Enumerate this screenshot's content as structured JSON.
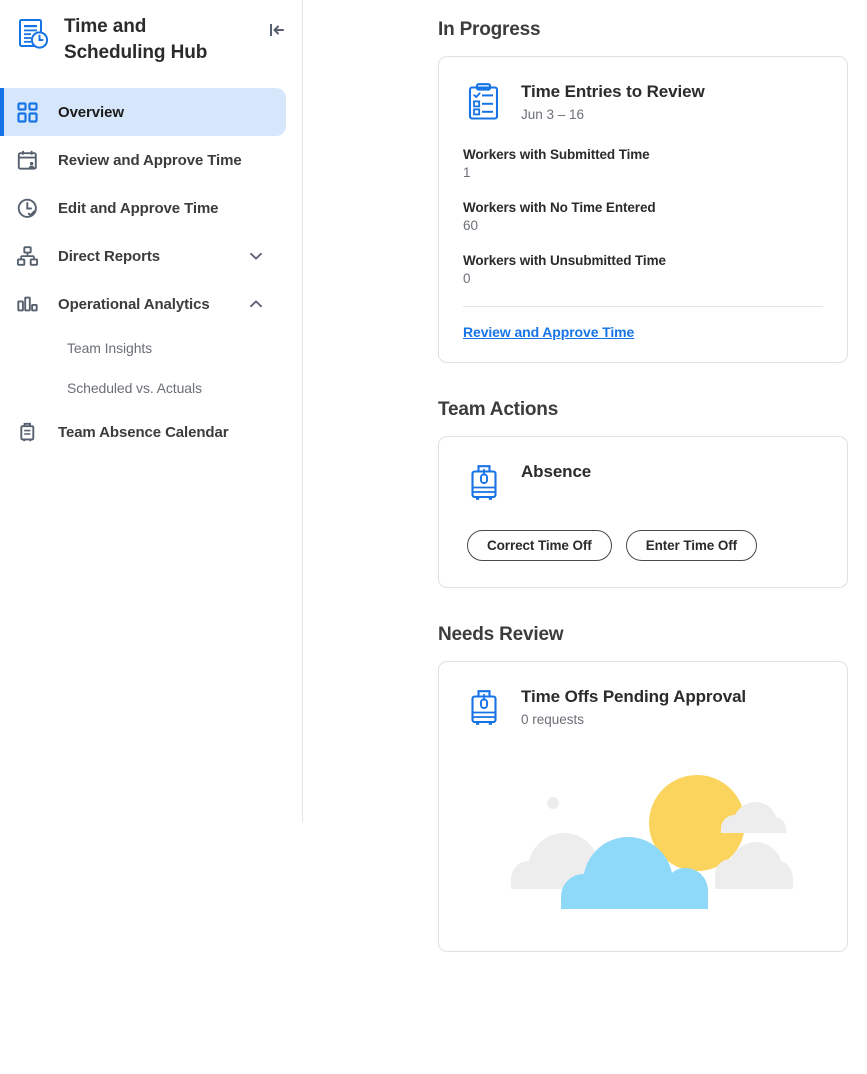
{
  "app": {
    "title": "Time and Scheduling Hub",
    "brand_icon": "document-clock-icon",
    "collapse_icon": "collapse-panel-left-icon",
    "accent_color": "#1774e6",
    "active_bg_color": "#d7e7fb"
  },
  "sidebar": {
    "items": [
      {
        "label": "Overview",
        "icon": "grid-dashboard-icon",
        "active": true
      },
      {
        "label": "Review and Approve Time",
        "icon": "calendar-person-icon",
        "active": false
      },
      {
        "label": "Edit and Approve Time",
        "icon": "clock-check-icon",
        "active": false
      },
      {
        "label": "Direct Reports",
        "icon": "org-chart-icon",
        "active": false,
        "chevron": "chevron-down-icon"
      },
      {
        "label": "Operational Analytics",
        "icon": "bar-chart-icon",
        "active": false,
        "chevron": "chevron-up-icon"
      },
      {
        "label": "Team Absence Calendar",
        "icon": "suitcase-icon",
        "active": false
      }
    ],
    "subitems": [
      {
        "label": "Team Insights"
      },
      {
        "label": "Scheduled vs. Actuals"
      }
    ]
  },
  "main": {
    "sections": {
      "in_progress": {
        "title": "In Progress",
        "card": {
          "icon": "clipboard-checklist-icon",
          "title": "Time Entries to Review",
          "subtitle": "Jun 3 – 16",
          "metrics": [
            {
              "label": "Workers with Submitted Time",
              "value": "1"
            },
            {
              "label": "Workers with No Time Entered",
              "value": "60"
            },
            {
              "label": "Workers with Unsubmitted Time",
              "value": "0"
            }
          ],
          "link": "Review and Approve Time"
        }
      },
      "team_actions": {
        "title": "Team Actions",
        "card": {
          "icon": "suitcase-icon",
          "title": "Absence",
          "buttons": [
            {
              "label": "Correct Time Off"
            },
            {
              "label": "Enter Time Off"
            }
          ]
        }
      },
      "needs_review": {
        "title": "Needs Review",
        "card": {
          "icon": "suitcase-icon",
          "title": "Time Offs Pending Approval",
          "subtitle": "0 requests",
          "illustration": "sun-clouds-empty-state-illustration",
          "illustration_colors": {
            "sun": "#fbd45e",
            "cloud_primary": "#8ed8f8",
            "cloud_secondary": "#ededed"
          }
        }
      }
    }
  }
}
